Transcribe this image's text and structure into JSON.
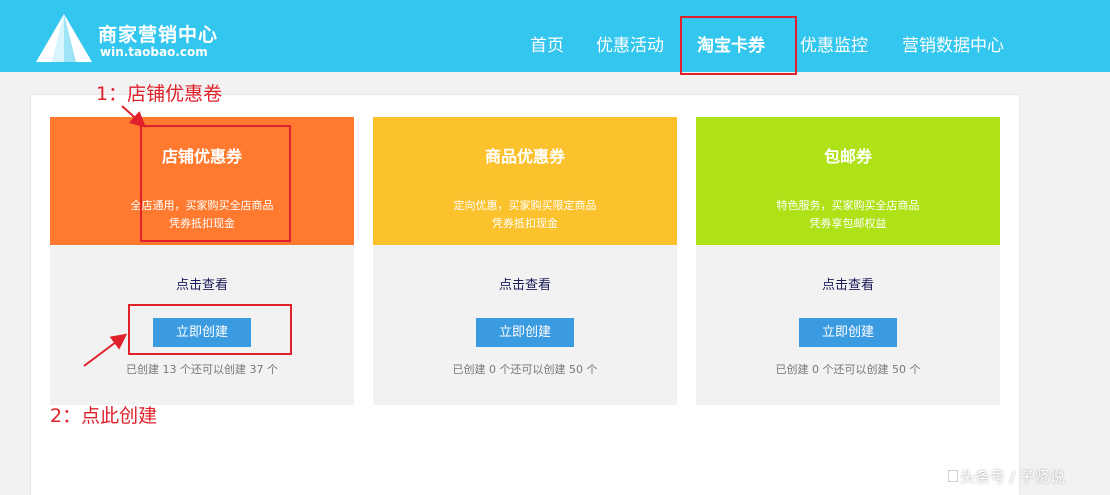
{
  "header": {
    "logo_title": "商家营销中心",
    "logo_subtitle": "win.taobao.com",
    "nav": [
      {
        "label": "首页",
        "active": false
      },
      {
        "label": "优惠活动",
        "active": false
      },
      {
        "label": "淘宝卡券",
        "active": true
      },
      {
        "label": "优惠监控",
        "active": false
      },
      {
        "label": "营销数据中心",
        "active": false
      }
    ]
  },
  "cards": [
    {
      "title": "店铺优惠券",
      "desc_line1": "全店通用，买家购买全店商品",
      "desc_line2": "凭券抵扣现金",
      "link": "点击查看",
      "button": "立即创建",
      "stat": "已创建 13 个还可以创建 37 个",
      "color": "#ff7a2f"
    },
    {
      "title": "商品优惠券",
      "desc_line1": "定向优惠，买家购买限定商品",
      "desc_line2": "凭券抵扣现金",
      "link": "点击查看",
      "button": "立即创建",
      "stat": "已创建 0 个还可以创建 50 个",
      "color": "#fbc22e"
    },
    {
      "title": "包邮券",
      "desc_line1": "特色服务，买家购买全店商品",
      "desc_line2": "凭券享包邮权益",
      "link": "点击查看",
      "button": "立即创建",
      "stat": "已创建 0 个还可以创建 50 个",
      "color": "#aee217"
    }
  ],
  "annotations": {
    "note1": "1：店铺优惠卷",
    "note2": "2：点此创建",
    "color": "#e0202a"
  },
  "watermark": "头条号 / 子贤说"
}
